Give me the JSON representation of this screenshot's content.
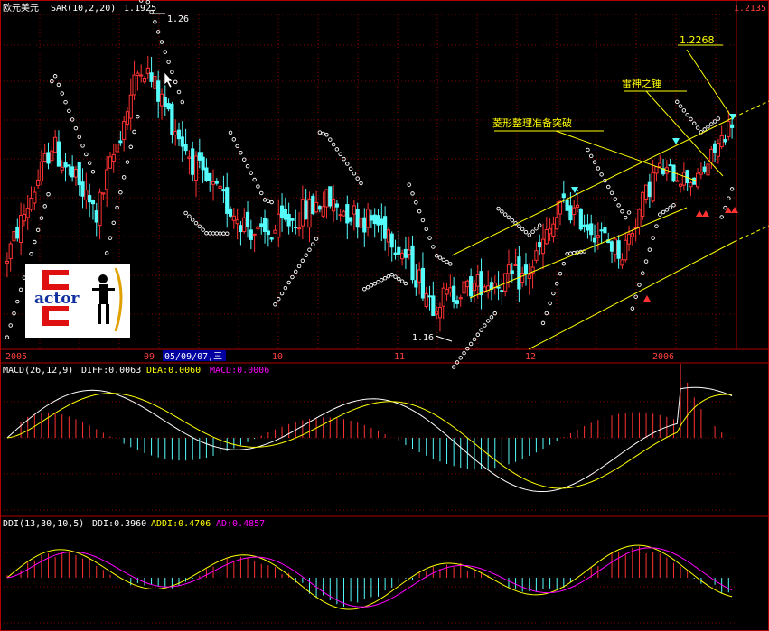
{
  "header": {
    "main_title": "欧元美元",
    "main_indicator": "SAR(10,2,20)",
    "main_value": "1.1925",
    "price_top_right": "1.2135"
  },
  "annotations": {
    "peak": "1.26",
    "low": "1.16",
    "target": "1.2268",
    "hammer": "雷神之锤",
    "diamond": "菱形整理准备突破"
  },
  "xaxis": {
    "labels": [
      "2005",
      "09",
      "05/09/07,三",
      "10",
      "11",
      "12",
      "2006"
    ]
  },
  "macd": {
    "title": "MACD(26,12,9)",
    "diff": "DIFF:0.0063",
    "dea": "DEA:0.0060",
    "macd": "MACD:0.0006"
  },
  "ddi": {
    "title": "DDI(13,30,10,5)",
    "ddi": "DDI:0.3960",
    "addi": "ADDI:0.4706",
    "ad": "AD:0.4857"
  },
  "logo": {
    "text": "actor"
  },
  "colors": {
    "up": "#ff3232",
    "down": "#54fcfc",
    "sar": "#ffffff",
    "channel": "#ffff00",
    "grid": "#b00000",
    "diff": "#ffffff",
    "dea": "#ffff00",
    "addi": "#ffff00",
    "ad": "#ff00ff",
    "axis_text": "#ff4040",
    "label_purple": "#ff00ff"
  },
  "chart_data": {
    "type": "candlestick",
    "series_name": "欧元美元",
    "yaxis_top_value": 1.2135,
    "segments": [
      {
        "from_index": 0,
        "to_index": 14,
        "start": 1.165,
        "end": 1.215,
        "noise": 0.01
      },
      {
        "from_index": 14,
        "to_index": 27,
        "start": 1.215,
        "end": 1.186,
        "noise": 0.012
      },
      {
        "from_index": 27,
        "to_index": 40,
        "start": 1.186,
        "end": 1.25,
        "noise": 0.012
      },
      {
        "from_index": 40,
        "to_index": 58,
        "start": 1.25,
        "end": 1.2,
        "noise": 0.012
      },
      {
        "from_index": 58,
        "to_index": 75,
        "start": 1.2,
        "end": 1.176,
        "noise": 0.012
      },
      {
        "from_index": 75,
        "to_index": 93,
        "start": 1.176,
        "end": 1.192,
        "noise": 0.012
      },
      {
        "from_index": 93,
        "to_index": 112,
        "start": 1.192,
        "end": 1.18,
        "noise": 0.012
      },
      {
        "from_index": 112,
        "to_index": 125,
        "start": 1.18,
        "end": 1.15,
        "noise": 0.012
      },
      {
        "from_index": 125,
        "to_index": 140,
        "start": 1.15,
        "end": 1.158,
        "noise": 0.01
      },
      {
        "from_index": 140,
        "to_index": 152,
        "start": 1.158,
        "end": 1.16,
        "noise": 0.012
      },
      {
        "from_index": 152,
        "to_index": 163,
        "start": 1.16,
        "end": 1.19,
        "noise": 0.012
      },
      {
        "from_index": 163,
        "to_index": 180,
        "start": 1.19,
        "end": 1.17,
        "noise": 0.01
      },
      {
        "from_index": 180,
        "to_index": 190,
        "start": 1.17,
        "end": 1.205,
        "noise": 0.01
      },
      {
        "from_index": 190,
        "to_index": 202,
        "start": 1.205,
        "end": 1.2,
        "noise": 0.008
      },
      {
        "from_index": 202,
        "to_index": 212,
        "start": 1.2,
        "end": 1.225,
        "noise": 0.008
      }
    ],
    "candle_count": 212,
    "annotated_points": [
      {
        "label": "1.26",
        "value": 1.26
      },
      {
        "label": "1.16",
        "value": 1.16
      },
      {
        "label": "1.2268",
        "value": 1.2268
      }
    ]
  }
}
